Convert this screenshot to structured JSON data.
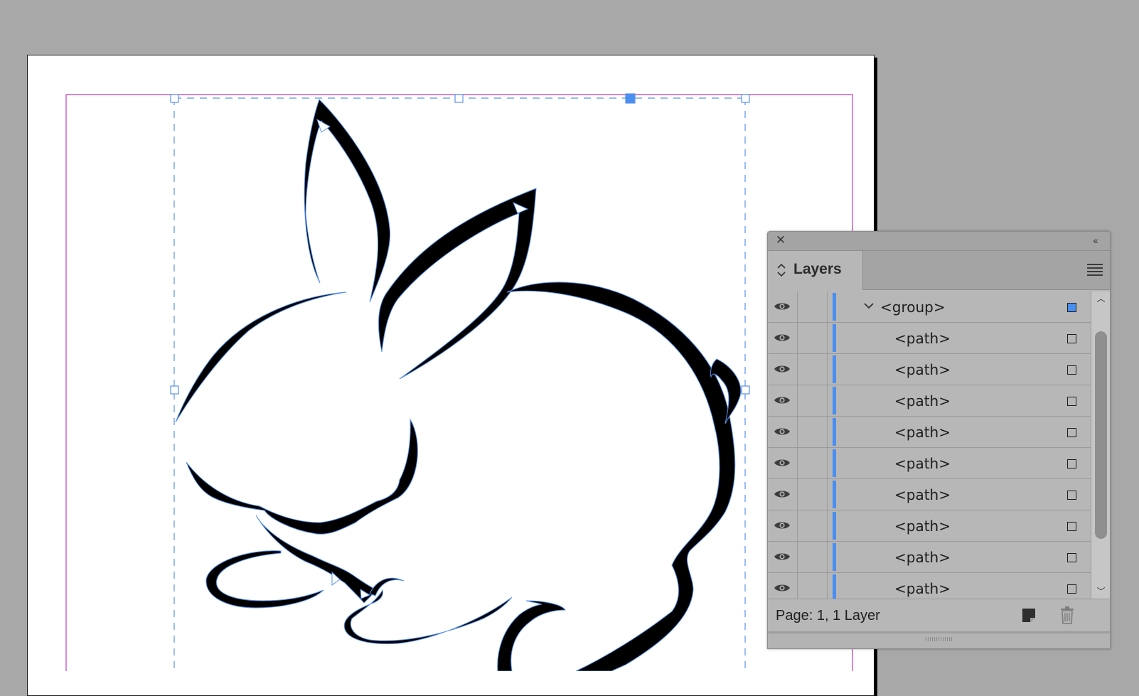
{
  "panel": {
    "tab_label": "Layers",
    "rows": [
      {
        "label": "<group>",
        "expanded": true,
        "selected": true
      },
      {
        "label": "<path>",
        "selected": false
      },
      {
        "label": "<path>",
        "selected": false
      },
      {
        "label": "<path>",
        "selected": false
      },
      {
        "label": "<path>",
        "selected": false
      },
      {
        "label": "<path>",
        "selected": false
      },
      {
        "label": "<path>",
        "selected": false
      },
      {
        "label": "<path>",
        "selected": false
      },
      {
        "label": "<path>",
        "selected": false
      },
      {
        "label": "<path>",
        "selected": false
      }
    ],
    "footer_text": "Page: 1, 1 Layer",
    "layer_color": "#4a8ef0"
  },
  "icons": {
    "close": "close-icon",
    "collapse": "collapse-panel-icon",
    "menu": "panel-menu-icon",
    "visibility": "eye-icon",
    "expand": "chevron-down-icon",
    "new_layer": "new-layer-icon",
    "delete": "trash-icon"
  },
  "colors": {
    "canvas": "#a8a8a8",
    "page": "#ffffff",
    "margin_guide": "#c13cc1",
    "selection": "#4a8ef0"
  }
}
